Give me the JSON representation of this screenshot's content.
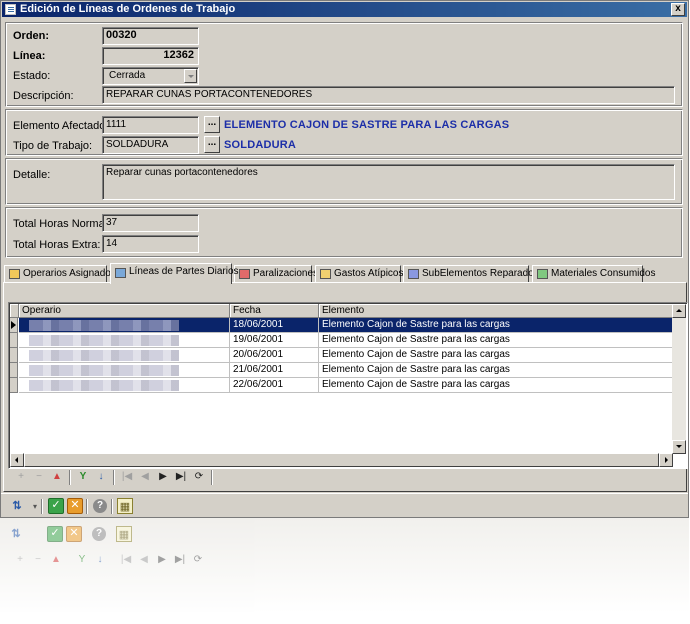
{
  "window": {
    "title": "Edición de Líneas de Ordenes de Trabajo",
    "close_glyph": "x"
  },
  "header_group": {
    "orden_label": "Orden:",
    "orden_value": "00320",
    "linea_label": "Línea:",
    "linea_value": "12362",
    "estado_label": "Estado:",
    "estado_value": "Cerrada",
    "descripcion_label": "Descripción:",
    "descripcion_value": "REPARAR CUNAS PORTACONTENEDORES"
  },
  "element_group": {
    "elemento_label": "Elemento Afectado:",
    "elemento_value": "1111",
    "elemento_desc": "ELEMENTO CAJON DE SASTRE PARA LAS CARGAS",
    "tipo_label": "Tipo de Trabajo:",
    "tipo_value": "SOLDADURA",
    "tipo_desc": "SOLDADURA",
    "ellipsis": "..."
  },
  "detail_group": {
    "detalle_label": "Detalle:",
    "detalle_value": "Reparar cunas portacontenedores"
  },
  "hours_group": {
    "normales_label": "Total Horas Normales:",
    "normales_value": "37",
    "extra_label": "Total Horas Extra:",
    "extra_value": "14"
  },
  "tabs": [
    {
      "label": "Operarios Asignados",
      "icon": "checkbox-icon",
      "color": "#e8a020"
    },
    {
      "label": "Líneas de Partes Diarios",
      "icon": "list-icon",
      "color": "#2a6ab8",
      "active": true
    },
    {
      "label": "Paralizaciones",
      "icon": "stop-icon",
      "color": "#c83030"
    },
    {
      "label": "Gastos Atípicos",
      "icon": "money-icon",
      "color": "#d8a020"
    },
    {
      "label": "SubElementos Reparados",
      "icon": "components-icon",
      "color": "#5060c0"
    },
    {
      "label": "Materiales Consumidos",
      "icon": "materials-icon",
      "color": "#40a040"
    }
  ],
  "grid": {
    "columns": [
      "Operario",
      "Fecha",
      "Elemento"
    ],
    "rows": [
      {
        "fecha": "18/06/2001",
        "elemento": "Elemento Cajon de Sastre para las cargas"
      },
      {
        "fecha": "19/06/2001",
        "elemento": "Elemento Cajon de Sastre para las cargas"
      },
      {
        "fecha": "20/06/2001",
        "elemento": "Elemento Cajon de Sastre para las cargas"
      },
      {
        "fecha": "21/06/2001",
        "elemento": "Elemento Cajon de Sastre para las cargas"
      },
      {
        "fecha": "22/06/2001",
        "elemento": "Elemento Cajon de Sastre para las cargas"
      }
    ]
  },
  "navigator": {
    "add": "+",
    "delete": "−",
    "up": "▲",
    "filter": "Y",
    "sort": "↓",
    "first": "|◀",
    "prev": "◀",
    "next": "▶",
    "last": "▶|",
    "refresh": "⟳"
  },
  "bottom_toolbar": {
    "tree": "⇅",
    "accept": "✓",
    "cancel": "✕",
    "help": "?",
    "calc": "▦"
  }
}
